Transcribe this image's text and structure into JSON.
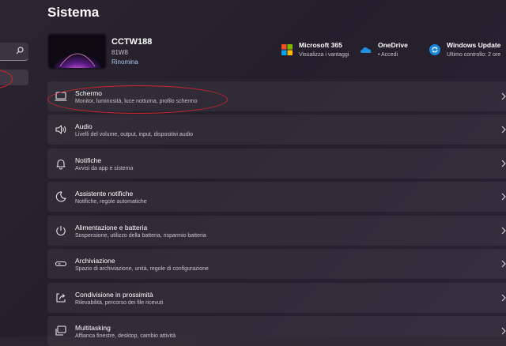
{
  "page": {
    "title": "Sistema"
  },
  "device": {
    "name": "CCTW188",
    "model": "81W8",
    "rename_label": "Rinomina"
  },
  "services": [
    {
      "title": "Microsoft 365",
      "subtitle": "Visualizza i vantaggi",
      "icon": "microsoft-365-icon"
    },
    {
      "title": "OneDrive",
      "subtitle": "• Accedi",
      "icon": "onedrive-icon"
    },
    {
      "title": "Windows Update",
      "subtitle": "Ultimo controllo: 2 ore",
      "icon": "windows-update-icon"
    }
  ],
  "settings": [
    {
      "title": "Schermo",
      "subtitle": "Monitor, luminosità, luce notturna, profilo schermo",
      "icon": "display-icon"
    },
    {
      "title": "Audio",
      "subtitle": "Livelli del volume, output, input, dispositivi audio",
      "icon": "speaker-icon"
    },
    {
      "title": "Notifiche",
      "subtitle": "Avvisi da app e sistema",
      "icon": "bell-icon"
    },
    {
      "title": "Assistente notifiche",
      "subtitle": "Notifiche, regole automatiche",
      "icon": "moon-icon"
    },
    {
      "title": "Alimentazione e batteria",
      "subtitle": "Sospensione, utilizzo della batteria, risparmio batteria",
      "icon": "power-icon"
    },
    {
      "title": "Archiviazione",
      "subtitle": "Spazio di archiviazione, unità, regole di configurazione",
      "icon": "storage-icon"
    },
    {
      "title": "Condivisione in prossimità",
      "subtitle": "Rilevabilità, percorso dei file ricevuti",
      "icon": "share-icon"
    },
    {
      "title": "Multitasking",
      "subtitle": "Affianca finestre, desktop, cambio attività",
      "icon": "multitasking-icon"
    }
  ],
  "colors": {
    "annotation": "#d0242c",
    "link": "#a9c8ec",
    "accent": "#0078d4"
  }
}
